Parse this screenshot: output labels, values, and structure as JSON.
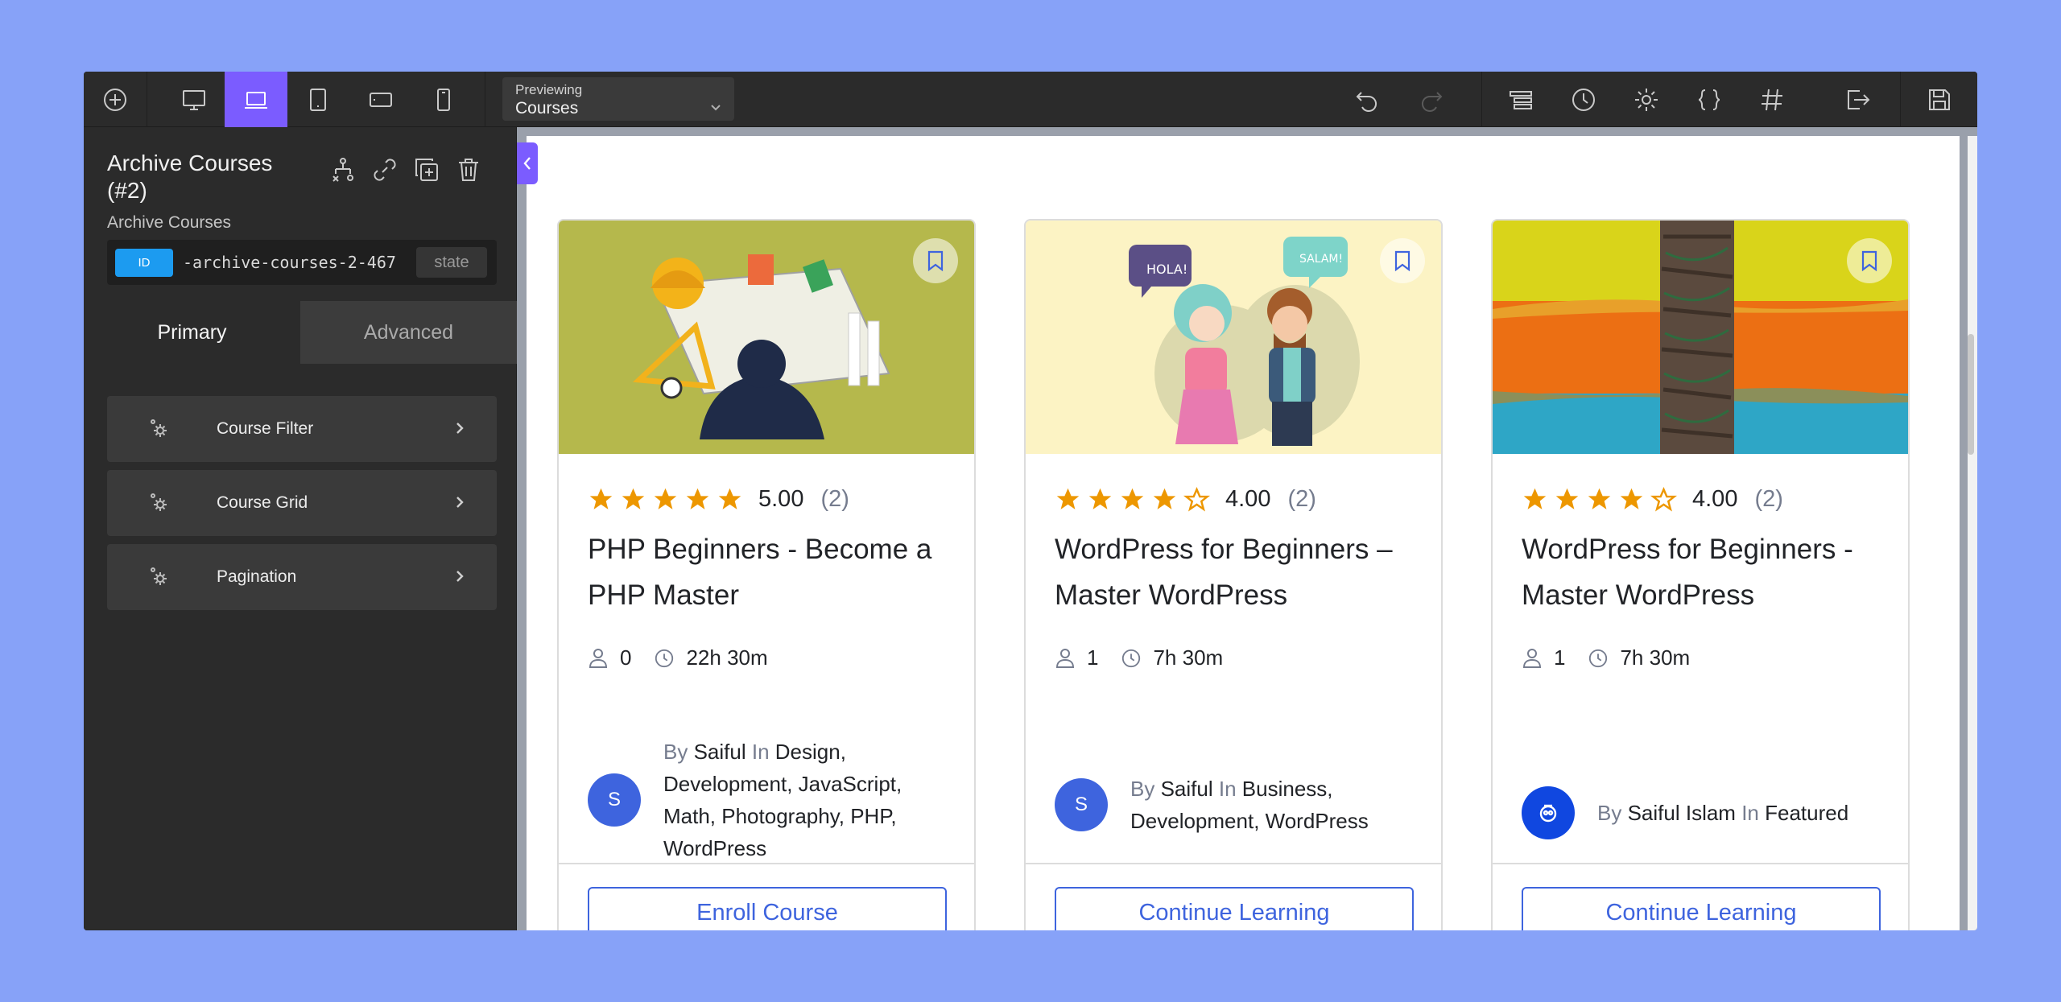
{
  "toolbar": {
    "previewing_label": "Previewing",
    "previewing_value": "Courses"
  },
  "panel": {
    "element_title": "Archive Courses (#2)",
    "element_subtitle": "Archive Courses",
    "id_badge": "ID",
    "id_value": "-archive-courses-2-467",
    "state_label": "state",
    "tabs": [
      "Primary",
      "Advanced"
    ],
    "sections": [
      "Course Filter",
      "Course Grid",
      "Pagination"
    ]
  },
  "courses": [
    {
      "rating": "5.00",
      "count": "(2)",
      "stars": 5,
      "title": "PHP Beginners - Become a PHP Master",
      "students": "0",
      "duration": "22h 30m",
      "by": "By",
      "author": "Saiful",
      "in": "In",
      "categories": "Design, Development, JavaScript, Math, Photography, PHP, WordPress",
      "avatar": "S",
      "cta": "Enroll Course"
    },
    {
      "rating": "4.00",
      "count": "(2)",
      "stars": 4,
      "title": "WordPress for Beginners – Master WordPress",
      "students": "1",
      "duration": "7h 30m",
      "by": "By",
      "author": "Saiful",
      "in": "In",
      "categories": "Business, Development, WordPress",
      "avatar": "S",
      "cta": "Continue Learning"
    },
    {
      "rating": "4.00",
      "count": "(2)",
      "stars": 4,
      "title": "WordPress for Beginners - Master WordPress",
      "students": "1",
      "duration": "7h 30m",
      "by": "By",
      "author": "Saiful Islam",
      "in": "In",
      "categories": "Featured",
      "avatar": "",
      "cta": "Continue Learning"
    }
  ],
  "thumbs": {
    "hola": "HOLA!",
    "salam": "SALAM!"
  },
  "colors": {
    "accent": "#7b5cff",
    "brand_blue": "#3e64de",
    "star": "#ed9700",
    "background": "#87a2f8"
  }
}
